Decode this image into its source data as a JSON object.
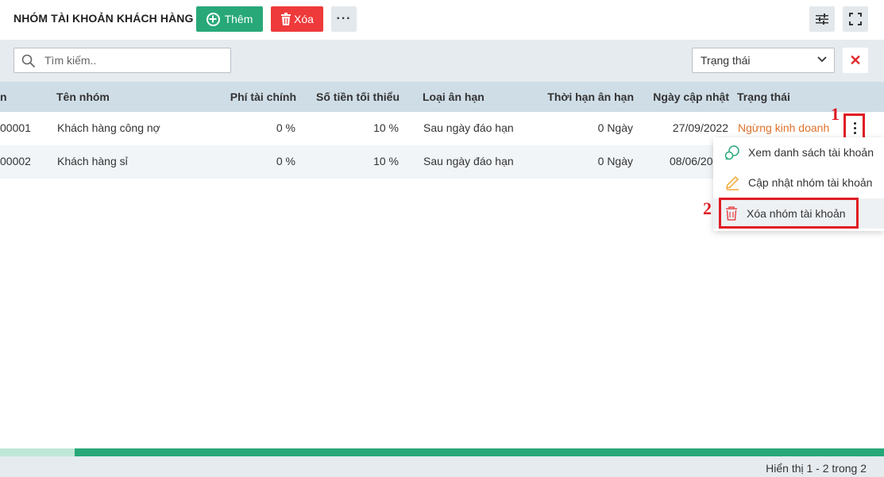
{
  "header": {
    "title": "NHÓM TÀI KHOẢN KHÁCH HÀNG",
    "add_label": "Thêm",
    "delete_label": "Xóa",
    "more_label": "···"
  },
  "toolbar": {
    "search_placeholder": "Tìm kiếm..",
    "status_filter": "Trạng thái",
    "clear_label": "✕"
  },
  "table": {
    "columns": [
      "n",
      "Tên nhóm",
      "Phí tài chính",
      "Số tiền tối thiểu",
      "Loại ân hạn",
      "Thời hạn ân hạn",
      "Ngày cập nhật",
      "Trạng thái"
    ],
    "rows": [
      {
        "code": "00001",
        "name": "Khách hàng công nợ",
        "fee": "0 %",
        "min": "10 %",
        "type": "Sau ngày đáo hạn",
        "term": "0 Ngày",
        "date": "27/09/2022",
        "status": "Ngừng kinh doanh"
      },
      {
        "code": "00002",
        "name": "Khách hàng sỉ",
        "fee": "0 %",
        "min": "10 %",
        "type": "Sau ngày đáo hạn",
        "term": "0 Ngày",
        "date": "08/06/20"
      }
    ]
  },
  "context_menu": {
    "items": [
      {
        "label": "Xem danh sách tài khoản",
        "icon": "chat-icon"
      },
      {
        "label": "Cập nhật nhóm tài khoản",
        "icon": "edit-icon"
      },
      {
        "label": "Xóa nhóm tài khoản",
        "icon": "trash-icon"
      }
    ]
  },
  "annotations": {
    "step1": "1",
    "step2": "2"
  },
  "footer": {
    "paging": "Hiển thị 1 - 2 trong 2"
  },
  "colors": {
    "primary": "#28a879",
    "danger": "#ee3a3a",
    "status_warning": "#e0722b",
    "annotation": "#e01b24"
  }
}
